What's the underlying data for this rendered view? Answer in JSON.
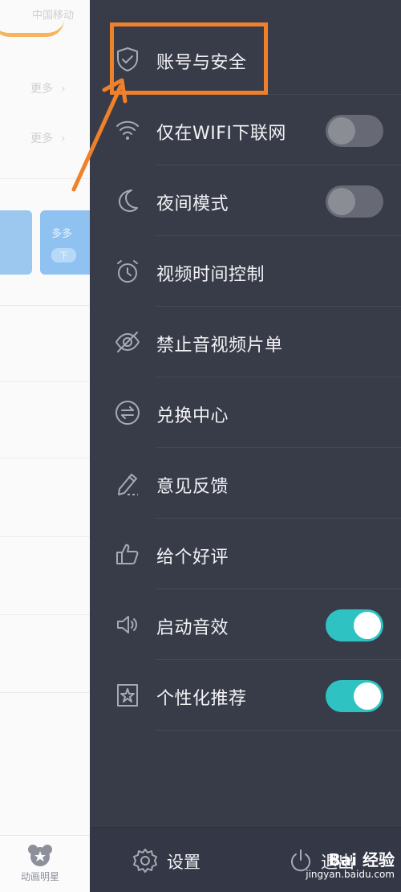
{
  "background_app": {
    "status_text": "中国移动",
    "row_labels": [
      "更多",
      "更多"
    ],
    "card_title": "多多",
    "card_pill": "下",
    "bottom_tab_label": "动画明星"
  },
  "drawer": {
    "items": [
      {
        "label": "账号与安全",
        "icon": "shield-check-icon",
        "toggle": null
      },
      {
        "label": "仅在WIFI下联网",
        "icon": "wifi-icon",
        "toggle": "off"
      },
      {
        "label": "夜间模式",
        "icon": "moon-icon",
        "toggle": "off"
      },
      {
        "label": "视频时间控制",
        "icon": "alarm-clock-icon",
        "toggle": null
      },
      {
        "label": "禁止音视频片单",
        "icon": "eye-off-icon",
        "toggle": null
      },
      {
        "label": "兑换中心",
        "icon": "exchange-icon",
        "toggle": null
      },
      {
        "label": "意见反馈",
        "icon": "pencil-icon",
        "toggle": null
      },
      {
        "label": "给个好评",
        "icon": "thumbs-up-icon",
        "toggle": null
      },
      {
        "label": "启动音效",
        "icon": "speaker-icon",
        "toggle": "on"
      },
      {
        "label": "个性化推荐",
        "icon": "star-badge-icon",
        "toggle": "on"
      }
    ],
    "footer": {
      "settings_label": "设置",
      "exit_label": "退出"
    }
  },
  "annotation": {
    "highlighted_item": "账号与安全",
    "color": "#f0802a"
  },
  "colors": {
    "drawer_bg": "#383c49",
    "toggle_on": "#2ec3c2",
    "toggle_off": "#676a75",
    "text": "#f2f2f5"
  },
  "watermark": {
    "brand": "Bai 经验",
    "url": "jingyan.baidu.com"
  }
}
